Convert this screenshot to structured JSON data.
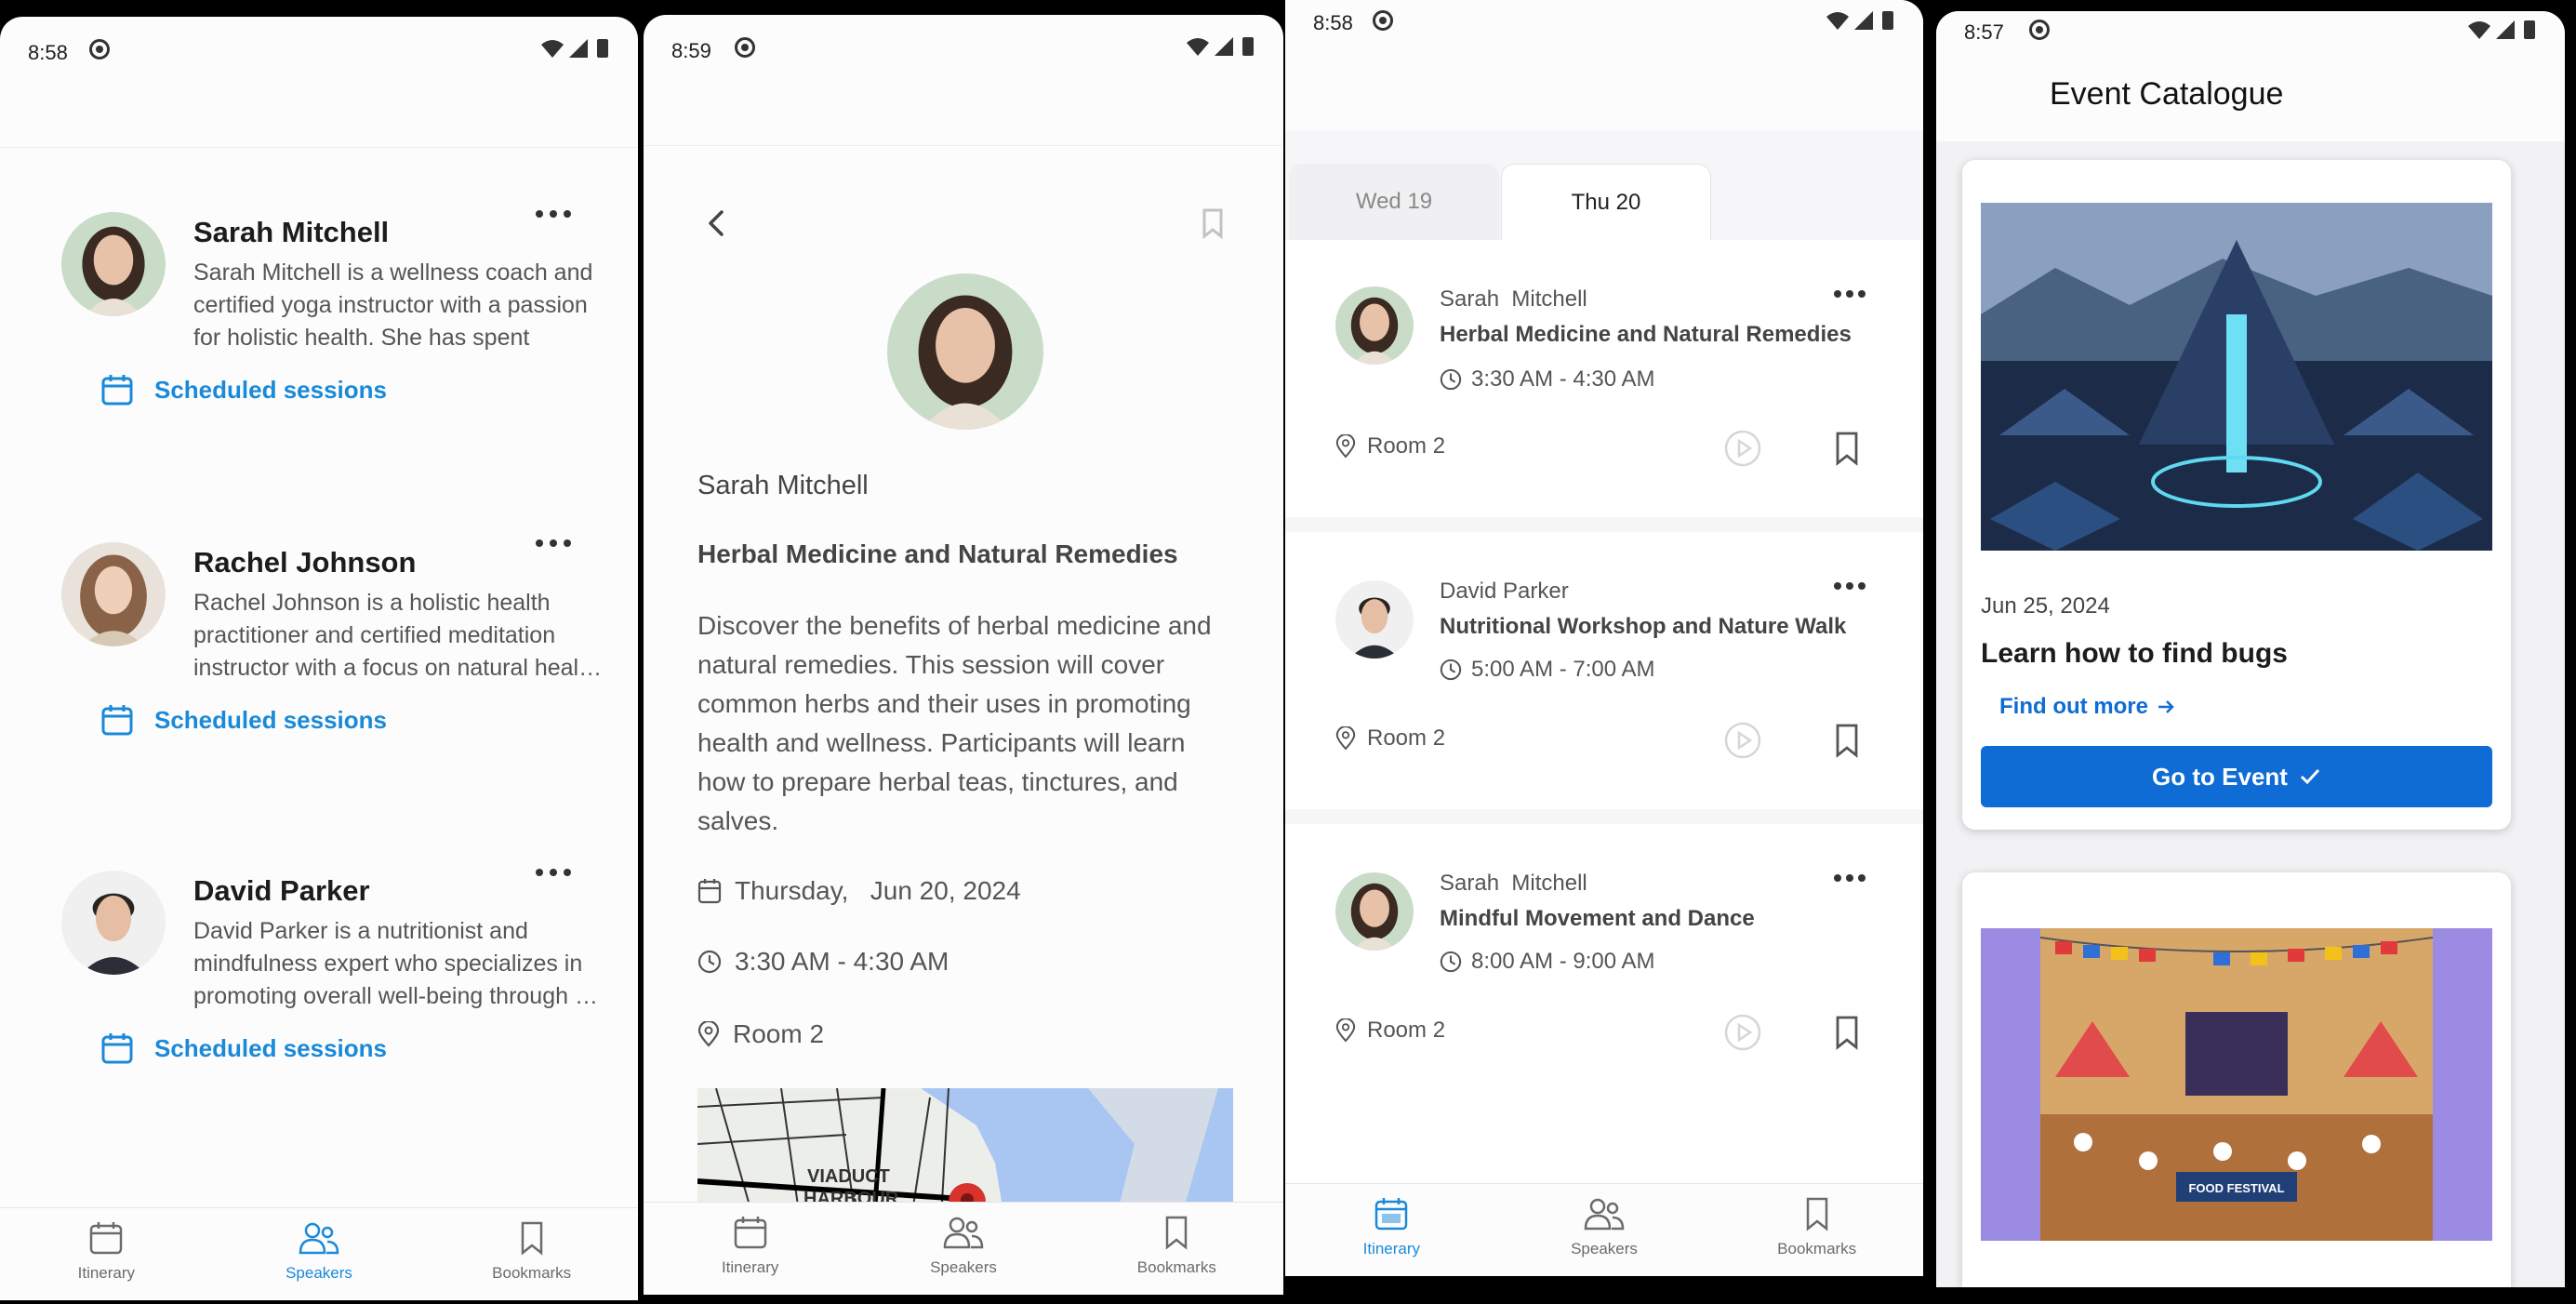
{
  "p1": {
    "time": "8:58",
    "speakers": [
      {
        "name": "Sarah  Mitchell",
        "bio": "Sarah Mitchell is a wellness coach and certified yoga instructor with a passion for holistic health. She has spent year…",
        "sessions_label": "Scheduled sessions"
      },
      {
        "name": "Rachel  Johnson",
        "bio": "Rachel Johnson is a holistic health practitioner and certified meditation instructor with a focus on natural heal…",
        "sessions_label": "Scheduled sessions"
      },
      {
        "name": "David Parker",
        "bio": "David Parker is a nutritionist and mindfulness expert who specializes in promoting overall well-being through …",
        "sessions_label": "Scheduled sessions"
      }
    ],
    "nav": {
      "itinerary": "Itinerary",
      "speakers": "Speakers",
      "bookmarks": "Bookmarks"
    }
  },
  "p2": {
    "time": "8:59",
    "speaker": "Sarah  Mitchell",
    "title": "Herbal Medicine and Natural Remedies",
    "description": "Discover the benefits of herbal medicine and natural remedies. This session will cover common herbs and their uses in promoting health and wellness. Participants will learn how to prepare herbal teas, tinctures, and salves.",
    "date": "Thursday,   Jun 20, 2024",
    "timerange": "3:30 AM - 4:30 AM",
    "room": "Room 2",
    "map_label_1": "VIADUCT",
    "map_label_2": "HARBOUR",
    "nav": {
      "itinerary": "Itinerary",
      "speakers": "Speakers",
      "bookmarks": "Bookmarks"
    }
  },
  "p3": {
    "time": "8:58",
    "tabs": [
      "Wed 19",
      "Thu 20"
    ],
    "sessions": [
      {
        "speaker": "Sarah  Mitchell",
        "title": "Herbal Medicine and Natural Remedies",
        "time": "3:30 AM - 4:30 AM",
        "room": "Room 2"
      },
      {
        "speaker": "David Parker",
        "title": "Nutritional Workshop and Nature Walk",
        "time": "5:00 AM - 7:00 AM",
        "room": "Room 2"
      },
      {
        "speaker": "Sarah  Mitchell",
        "title": "Mindful Movement and Dance",
        "time": "8:00 AM - 9:00 AM",
        "room": "Room 2"
      }
    ],
    "nav": {
      "itinerary": "Itinerary",
      "speakers": "Speakers",
      "bookmarks": "Bookmarks"
    }
  },
  "p4": {
    "time": "8:57",
    "title": "Event Catalogue",
    "event": {
      "date": "Jun 25, 2024",
      "title": "Learn how to find bugs",
      "link": "Find out more",
      "button": "Go to Event"
    },
    "banner_text": "FOOD FESTIVAL"
  },
  "colors": {
    "accent": "#1a8ad8",
    "button": "#0f6cd4",
    "background": "#fcfcfd"
  }
}
